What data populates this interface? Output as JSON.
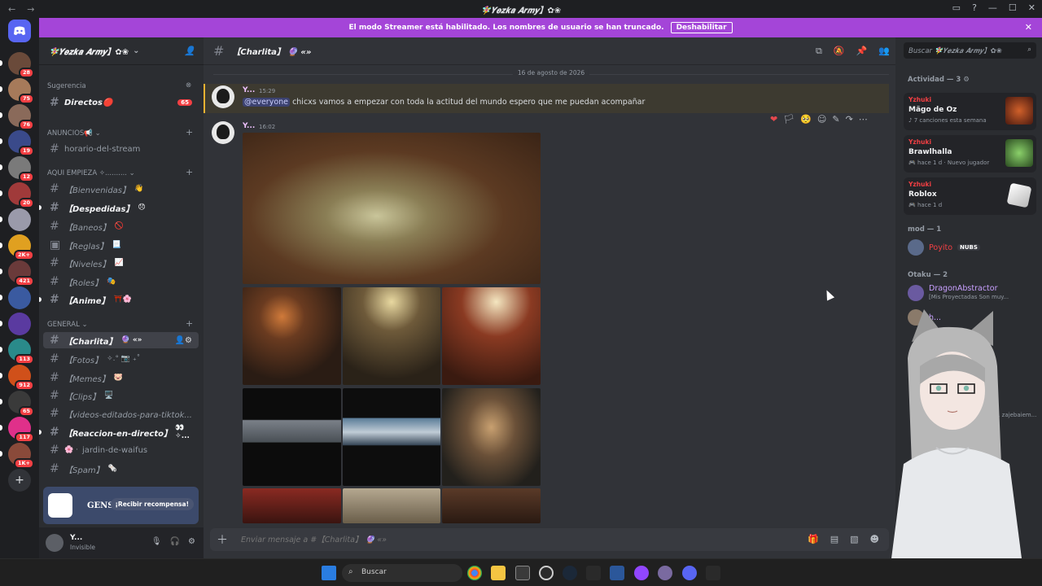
{
  "titlebar": {
    "title": "🧚‍♀️𝒀𝒆𝒛𝒌𝒂 𝑨𝒓𝒎𝒚】✿❀",
    "back": "←",
    "forward": "→"
  },
  "banner": {
    "text": "El modo Streamer está habilitado. Los nombres de usuario se han truncado.",
    "button": "Deshabilitar"
  },
  "servers": [
    {
      "badge": "28"
    },
    {
      "badge": "75"
    },
    {
      "badge": "76"
    },
    {
      "badge": "19"
    },
    {
      "badge": "12"
    },
    {
      "badge": "20"
    },
    {
      "badge": ""
    },
    {
      "badge": "2K+"
    },
    {
      "badge": "421"
    },
    {
      "badge": ""
    },
    {
      "badge": ""
    },
    {
      "badge": "113"
    },
    {
      "badge": "912"
    },
    {
      "badge": "65"
    },
    {
      "badge": "117"
    },
    {
      "badge": "1K+"
    }
  ],
  "sidebar": {
    "server_name": "🧚‍♀️𝒀𝒆𝒛𝒌𝒂 𝑨𝒓𝒎𝒚】✿❀",
    "suggestion_label": "Sugerencia",
    "suggestion_channel": "Directos🔴",
    "suggestion_badge": "65",
    "categories": [
      {
        "name": "ANUNCIOS📢"
      },
      {
        "name": "AQUI EMPIEZA ✧.........."
      },
      {
        "name": "GENERAL"
      }
    ],
    "channels": [
      {
        "name": "horario-del-stream",
        "emoji": ""
      },
      {
        "name": "【Bienvenidas】",
        "emoji": "👋"
      },
      {
        "name": "【Despedidas】",
        "emoji": "😞"
      },
      {
        "name": "【Baneos】",
        "emoji": "🚫"
      },
      {
        "name": "【Reglas】",
        "emoji": "📃"
      },
      {
        "name": "【Niveles】",
        "emoji": "📈"
      },
      {
        "name": "【Roles】",
        "emoji": "🎭"
      },
      {
        "name": "【Anime】",
        "emoji": "⛩️🌸"
      },
      {
        "name": "【Charlita】",
        "emoji": "🔮 «»"
      },
      {
        "name": "【Fotos】",
        "emoji": "✧.° 📷 ₊˚"
      },
      {
        "name": "【Memes】",
        "emoji": "🐷"
      },
      {
        "name": "【Clips】",
        "emoji": "🖥️"
      },
      {
        "name": "【videos-editados-para-tiktok...",
        "emoji": ""
      },
      {
        "name": "【Reaccion-en-directo】",
        "emoji": "👀✧..."
      },
      {
        "name": "jardin-de-waifus",
        "emoji": "🌸 ·"
      },
      {
        "name": "【Spam】",
        "emoji": "🗞️"
      }
    ]
  },
  "promo": {
    "game": "GENSHIN IMPACT",
    "button": "¡Recibir recompensa!"
  },
  "user": {
    "name": "Y...",
    "status": "Invisible"
  },
  "chat": {
    "channel_title": "【Charlita】 🔮 «»",
    "date_separator": "16 de agosto de 2026",
    "messages": [
      {
        "author": "Y...",
        "time": "15:29",
        "mention": "@everyone",
        "text": "chicxs vamos a empezar con toda la actitud del mundo espero que me puedan acompañar"
      },
      {
        "author": "Y...",
        "time": "16:02"
      }
    ],
    "composer_placeholder": "Enviar mensaje a #【Charlita】 🔮 «»"
  },
  "members": {
    "search_placeholder": "Buscar 🧚‍♀️𝒀𝒆𝒛𝒌𝒂 𝑨𝒓𝒎𝒚】✿❀",
    "activity_header": "Actividad — 3",
    "activities": [
      {
        "who": "Yzhuki",
        "game": "Mägo de Oz",
        "sub": "7 canciones esta semana"
      },
      {
        "who": "Yzhuki",
        "game": "Brawlhalla",
        "sub": "hace 1 d",
        "extra": "Nuevo jugador"
      },
      {
        "who": "Yzhuki",
        "game": "Roblox",
        "sub": "hace 1 d"
      }
    ],
    "groups": [
      {
        "title": "mod — 1",
        "members": [
          {
            "name": "Poyito",
            "tag": "NUBS"
          }
        ]
      },
      {
        "title": "Otaku — 2",
        "members": [
          {
            "name": "DragonAbstractor",
            "status": "[Mis Proyectadas Son muy..."
          },
          {
            "name": "h..."
          }
        ]
      }
    ],
    "partial_text": "ia, zajebaiem..."
  },
  "taskbar": {
    "search": "Buscar"
  }
}
